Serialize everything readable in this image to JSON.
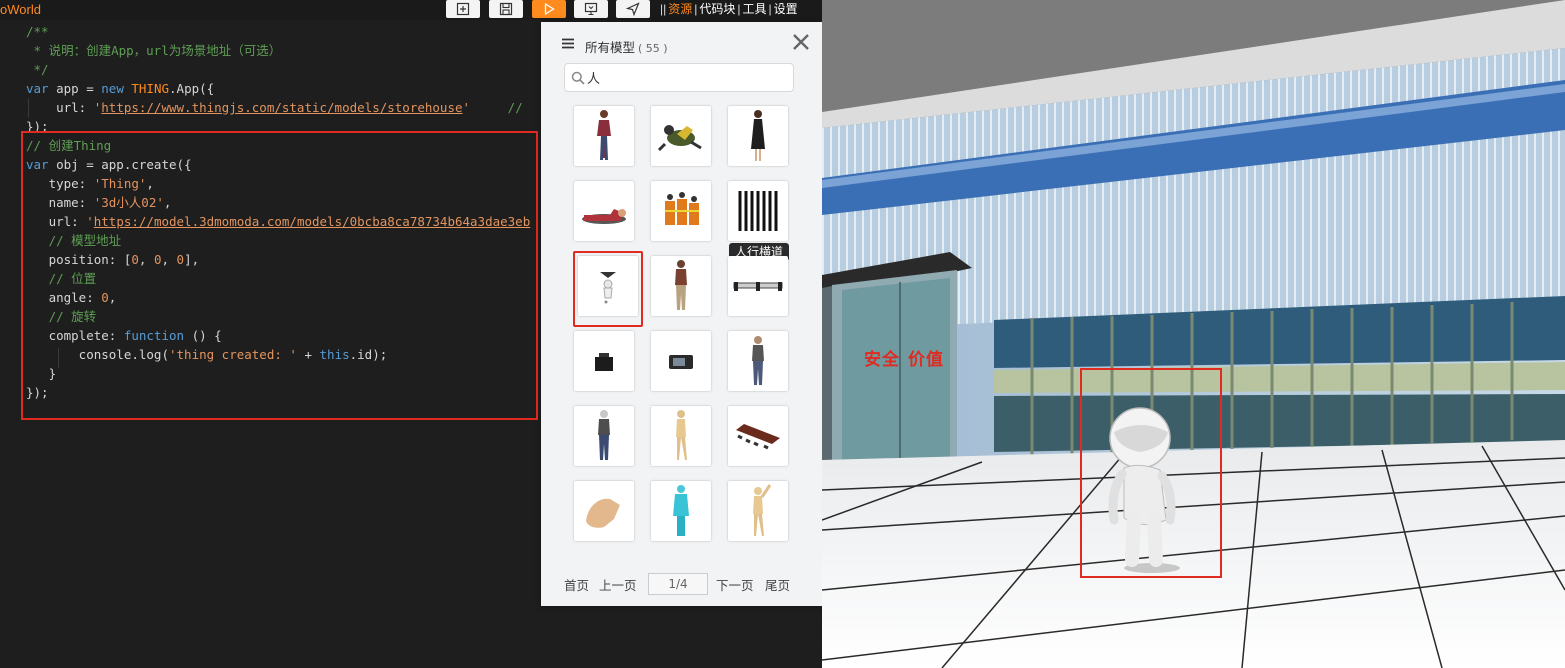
{
  "app": {
    "brand": "oWorld",
    "menu": [
      "资源",
      "代码块",
      "工具",
      "设置"
    ],
    "menu_active": "资源",
    "accent_color": "#ff8a1e",
    "highlight_color": "#e02b20"
  },
  "toolbar": {
    "buttons": [
      "new-file-icon",
      "save-icon",
      "run-icon",
      "screen-icon",
      "send-icon"
    ]
  },
  "editor": {
    "lines": [
      "/**",
      " * 说明：创建App，url为场景地址（可选）",
      " */",
      "var app = new THING.App({",
      "    url: 'https://www.thingjs.com/static/models/storehouse'     //",
      "});",
      "// 创建Thing",
      "var obj = app.create({",
      "   type: 'Thing',",
      "   name: '3d小人02',",
      "   url: 'https://model.3dmomoda.com/models/0bcba8ca78734b64a3dae3eb",
      "   // 模型地址",
      "   position: [0, 0, 0],",
      "   // 位置",
      "   angle: 0,",
      "   // 旋转",
      "   complete: function () {",
      "       console.log('thing created: ' + this.id);",
      "   }",
      "});"
    ]
  },
  "panel": {
    "title": "所有模型",
    "count": "( 55 )",
    "search_value": "人",
    "tooltip": "人行横道",
    "pager": {
      "first": "首页",
      "prev": "上一页",
      "page": "1/4",
      "next": "下一页",
      "last": "尾页"
    }
  },
  "scene": {
    "signs": [
      "安全",
      "价值"
    ]
  }
}
